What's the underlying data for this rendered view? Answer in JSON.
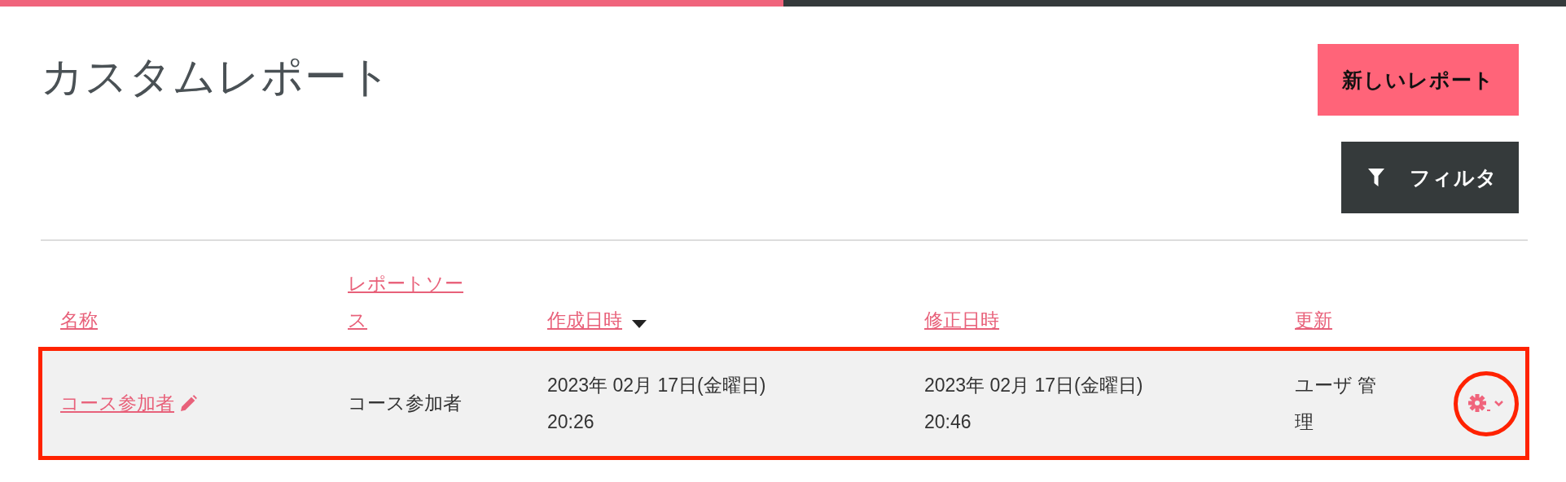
{
  "progress": {
    "level": 0.5
  },
  "title": "カスタムレポート",
  "buttons": [
    {
      "label": "新しいレポート",
      "kind": "primary"
    },
    {
      "label": "フィルタ",
      "kind": "filter"
    }
  ],
  "table": {
    "columns": [
      {
        "label": "名称",
        "sorted": false
      },
      {
        "label": "レポートソース",
        "sorted": false
      },
      {
        "label": "作成日時",
        "sorted": true
      },
      {
        "label": "修正日時",
        "sorted": false
      },
      {
        "label": "更新",
        "sorted": false
      }
    ],
    "rows": [
      {
        "name": "コース参加者",
        "source": "コース参加者",
        "created": [
          "2023年 02月 17日(金曜日)",
          "20:26"
        ],
        "modified": [
          "2023年 02月 17日(金曜日)",
          "20:46"
        ],
        "updated": "ユーザ 管理",
        "highlighted": true,
        "action_highlighted": true
      }
    ]
  }
}
